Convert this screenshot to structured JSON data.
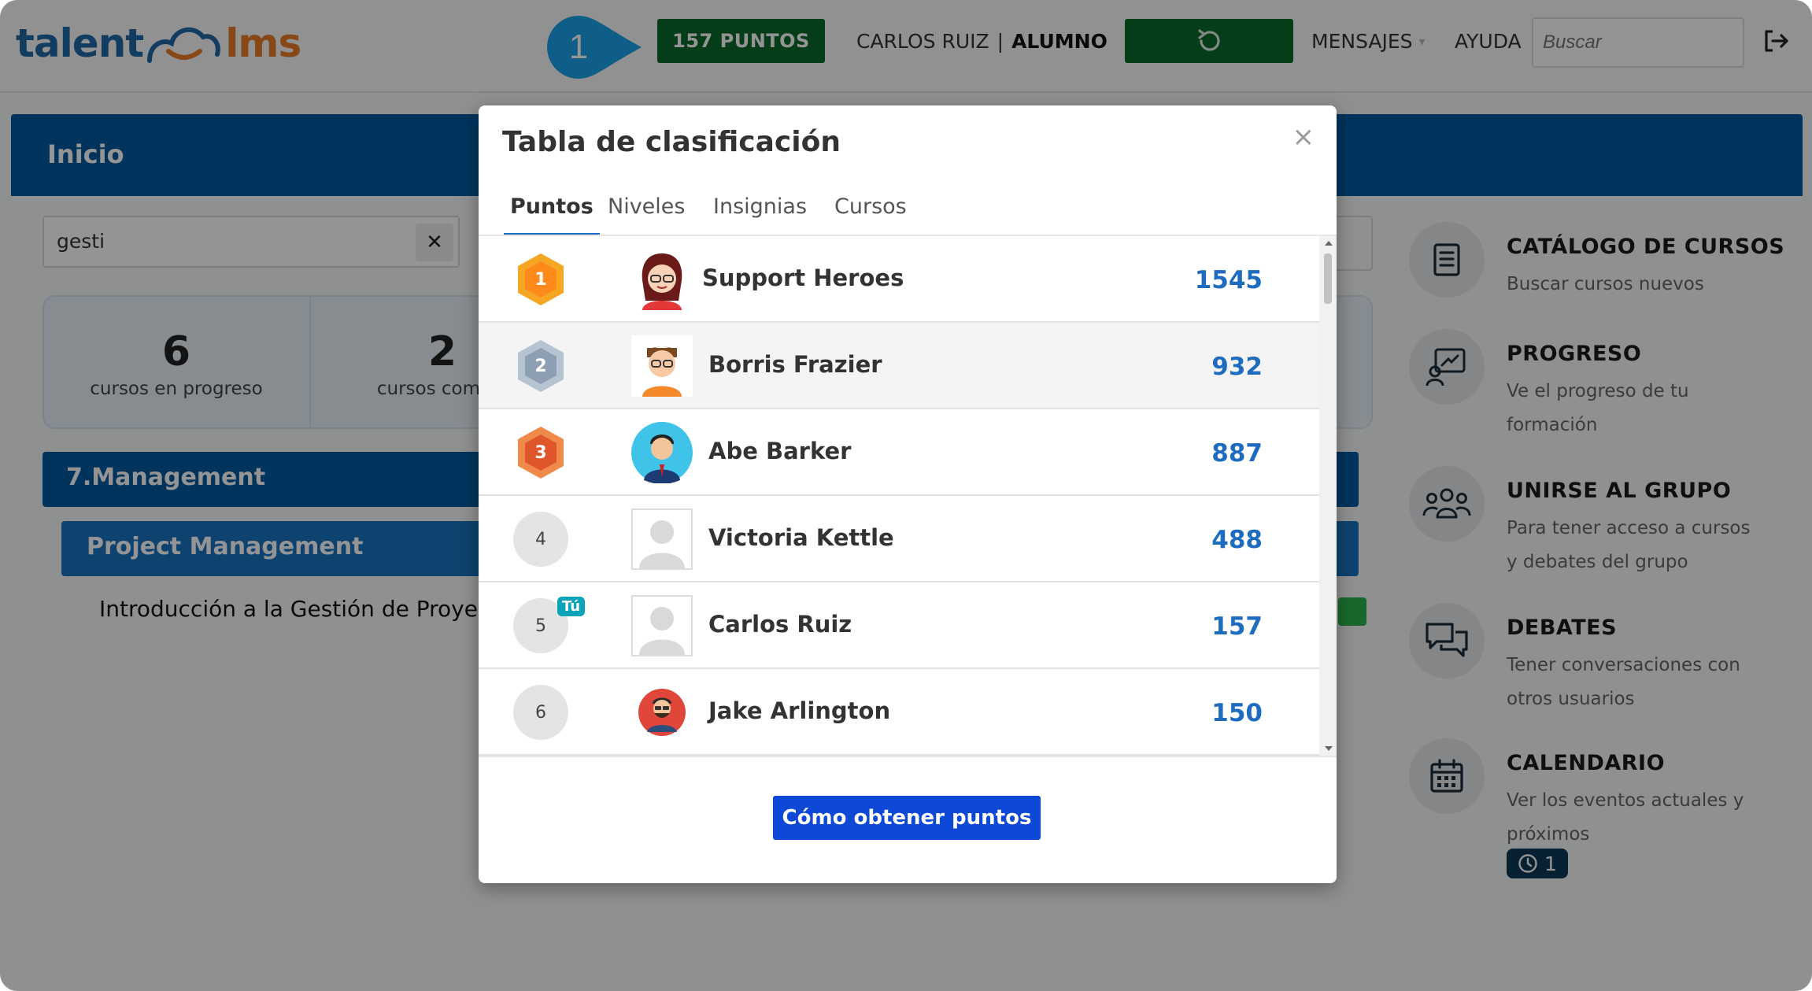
{
  "header": {
    "logo_part1": "talent",
    "logo_part2": "lms",
    "step_number": "1",
    "points_label": "157 PUNTOS",
    "user_name": "CARLOS RUIZ",
    "user_separator": "|",
    "user_role": "ALUMNO",
    "messages_label": "MENSAJES",
    "help_label": "AYUDA",
    "search_placeholder": "Buscar",
    "icons": [
      "resume-icon",
      "logout-icon"
    ]
  },
  "page": {
    "title": "Inicio",
    "filter_value": "gesti",
    "filter_clear": "✕",
    "stats": [
      {
        "value": "6",
        "label": "cursos en progreso"
      },
      {
        "value": "2",
        "label": "cursos comple"
      }
    ],
    "category": "7.Management",
    "subcategory": "Project Management",
    "course_title": "Introducción a la Gestión de Proyect"
  },
  "sidebar": {
    "items": [
      {
        "title": "CATÁLOGO DE CURSOS",
        "desc": "Buscar cursos nuevos",
        "icon": "catalog-icon"
      },
      {
        "title": "PROGRESO",
        "desc": "Ve el progreso de tu formación",
        "icon": "progress-icon"
      },
      {
        "title": "UNIRSE AL GRUPO",
        "desc": "Para tener acceso a cursos y debates del grupo",
        "icon": "group-icon"
      },
      {
        "title": "DEBATES",
        "desc": "Tener conversaciones con otros usuarios",
        "icon": "discussions-icon"
      },
      {
        "title": "CALENDARIO",
        "desc": "Ver los eventos actuales y próximos",
        "icon": "calendar-icon"
      }
    ],
    "calendar_badge": "1"
  },
  "modal": {
    "title": "Tabla de clasificación",
    "close": "×",
    "tabs": [
      "Puntos",
      "Niveles",
      "Insignias",
      "Cursos"
    ],
    "active_tab": "Puntos",
    "you_badge": "Tú",
    "rows": [
      {
        "rank": "1",
        "name": "Support Heroes",
        "score": "1545"
      },
      {
        "rank": "2",
        "name": "Borris Frazier",
        "score": "932"
      },
      {
        "rank": "3",
        "name": "Abe Barker",
        "score": "887"
      },
      {
        "rank": "4",
        "name": "Victoria Kettle",
        "score": "488"
      },
      {
        "rank": "5",
        "name": "Carlos Ruiz",
        "score": "157"
      },
      {
        "rank": "6",
        "name": "Jake Arlington",
        "score": "150"
      }
    ],
    "how_to_button": "Cómo obtener puntos"
  },
  "colors": {
    "brand_blue": "#005aa0",
    "points_green": "#0b6a2c",
    "link_blue": "#1e6cbf",
    "button_blue": "#0d49d6",
    "marker_cyan": "#1aa3e8",
    "gold_medal": "#f5a623",
    "silver_medal": "#8e9fb3",
    "bronze_medal": "#e0562b"
  }
}
